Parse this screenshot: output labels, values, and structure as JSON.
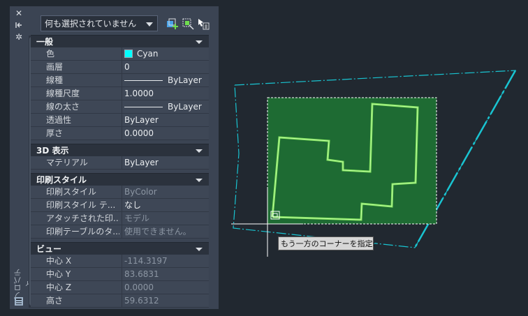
{
  "rail": {
    "close_icon": "close-icon",
    "autohide_icon": "autohide-icon",
    "settings_icon": "gear-icon",
    "title": "プロパティ"
  },
  "toolbar": {
    "selection_value": "何も選択されていません",
    "quick_select_icon": "quick-select-icon",
    "select_objects_icon": "select-objects-icon",
    "pickadd_icon": "pickadd-toggle-icon"
  },
  "sections": {
    "general": {
      "title": "一般",
      "rows": [
        {
          "label": "色",
          "value": "Cyan"
        },
        {
          "label": "画層",
          "value": "0"
        },
        {
          "label": "線種",
          "value": "ByLayer"
        },
        {
          "label": "線種尺度",
          "value": "1.0000"
        },
        {
          "label": "線の太さ",
          "value": "ByLayer"
        },
        {
          "label": "透過性",
          "value": "ByLayer"
        },
        {
          "label": "厚さ",
          "value": "0.0000"
        }
      ]
    },
    "3d": {
      "title": "3D 表示",
      "rows": [
        {
          "label": "マテリアル",
          "value": "ByLayer"
        }
      ]
    },
    "plot": {
      "title": "印刷スタイル",
      "rows": [
        {
          "label": "印刷スタイル",
          "value": "ByColor"
        },
        {
          "label": "印刷スタイル テ...",
          "value": "なし"
        },
        {
          "label": "アタッチされた印...",
          "value": "モデル"
        },
        {
          "label": "印刷テーブルのタ...",
          "value": "使用できません。"
        }
      ]
    },
    "view": {
      "title": "ビュー",
      "rows": [
        {
          "label": "中心 X",
          "value": "-114.3197"
        },
        {
          "label": "中心 Y",
          "value": "83.6831"
        },
        {
          "label": "中心 Z",
          "value": "0.0000"
        },
        {
          "label": "高さ",
          "value": "59.6312"
        }
      ]
    }
  },
  "canvas": {
    "tooltip": "もう一方のコーナーを指定:",
    "colors": {
      "selection_fill": "#1e6b33",
      "polyline": "#7fe35a",
      "boundary": "#19c4d1",
      "crosshair": "#ffffff",
      "background": "#212830"
    }
  }
}
